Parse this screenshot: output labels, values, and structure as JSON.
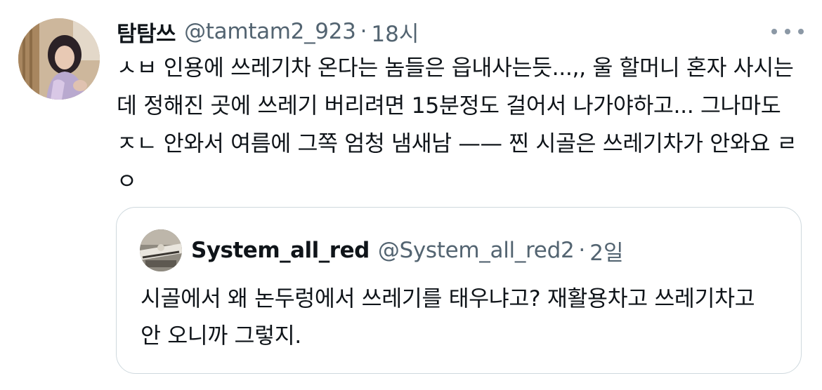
{
  "tweet": {
    "author": {
      "display_name": "탐탐쓰",
      "handle": "@tamtam2_923",
      "avatar": "profile-photo"
    },
    "separator": "·",
    "time": "18시",
    "more_icon": "more-horizontal-icon",
    "text": "ㅅㅂ 인용에 쓰레기차 온다는 놈들은 읍내사는듯...,, 울 할머니 혼자 사시는데 정해진 곳에 쓰레기 버리려면 15분정도 걸어서 나가야하고... 그나마도  ㅈㄴ 안와서 여름에 그쪽 엄청 냄새남 —— 찐 시골은 쓰레기차가 안와요 ㄹㅇ"
  },
  "quoted_tweet": {
    "author": {
      "display_name": "System_all_red",
      "handle": "@System_all_red2",
      "avatar": "profile-photo"
    },
    "separator": "·",
    "time": "2일",
    "text": "시골에서 왜 논두렁에서 쓰레기를 태우냐고? 재활용차고 쓰레기차고 안 오니까 그렇지."
  },
  "colors": {
    "text_primary": "#0f1419",
    "text_secondary": "#536471",
    "border": "#cfd9de"
  }
}
